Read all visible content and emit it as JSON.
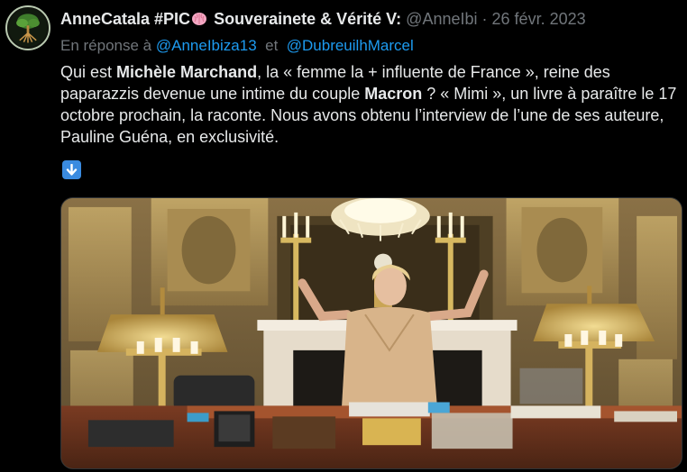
{
  "author": {
    "display_name": "AnneCatala #PIC",
    "display_name_suffix": "Souverainete & Vérité V:",
    "handle": "@AnneIbi",
    "separator": "·",
    "date": "26 févr. 2023",
    "avatar_icon": "tree-roots-avatar-icon",
    "name_emoji_icon": "brain-emoji-icon"
  },
  "reply": {
    "prefix": "En réponse à",
    "mention_1": "@AnneIbiza13",
    "joiner": "et",
    "mention_2": "@DubreuilhMarcel"
  },
  "body": {
    "t1": "Qui est ",
    "b1": "Michèle Marchand",
    "t2": ", la « femme la + influente de France », reine des paparazzis devenue une intime du couple ",
    "b2": "Macron",
    "t3": " ? « Mimi », un livre à paraître le 17 octobre prochain, la raconte. Nous avons obtenu l’interview de l’une de ses auteure, Pauline Guéna, en exclusivité."
  },
  "emoji_icon": "down-arrow-emoji-icon",
  "media": {
    "icon": "photo-icon"
  },
  "colors": {
    "background": "#000000",
    "text": "#e7e9ea",
    "muted": "#71767b",
    "link": "#1d9bf0"
  }
}
